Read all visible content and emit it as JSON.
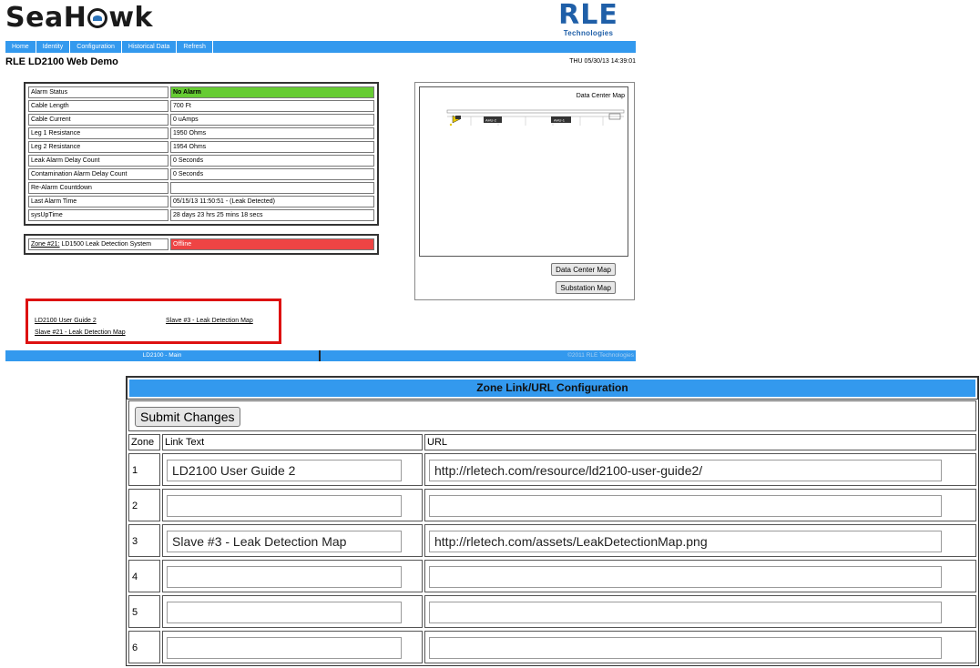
{
  "brand": {
    "logo_left": "SeaHawk",
    "logo_left_a": "SeaH",
    "logo_left_b": "wk",
    "logo_right": "RLE",
    "logo_right_sub": "Technologies"
  },
  "colors": {
    "accent": "#3399ee",
    "ok": "#66cc33",
    "alarm": "#ee4444",
    "highlight": "#dd1111"
  },
  "nav": {
    "items": [
      "Home",
      "Identity",
      "Configuration",
      "Historical Data",
      "Refresh"
    ]
  },
  "header": {
    "title": "RLE LD2100 Web Demo",
    "datetime": "THU 05/30/13 14:39:01"
  },
  "status": {
    "rows": [
      {
        "label": "Alarm Status",
        "value": "No Alarm"
      },
      {
        "label": "Cable Length",
        "value": "700 Ft"
      },
      {
        "label": "Cable Current",
        "value": "0 uAmps"
      },
      {
        "label": "Leg 1 Resistance",
        "value": "1950 Ohms"
      },
      {
        "label": "Leg 2 Resistance",
        "value": "1954 Ohms"
      },
      {
        "label": "Leak Alarm Delay Count",
        "value": "0 Seconds"
      },
      {
        "label": "Contamination Alarm Delay Count",
        "value": "0 Seconds"
      },
      {
        "label": "Re-Alarm Countdown",
        "value": ""
      },
      {
        "label": "Last Alarm Time",
        "value": "05/15/13 11:50:51  -  (Leak Detected)"
      },
      {
        "label": "sysUpTime",
        "value": "28 days 23 hrs 25 mins 18 secs"
      }
    ],
    "zone": {
      "link": "Zone #21:",
      "label": " LD1500 Leak Detection System",
      "value": "Offline"
    }
  },
  "map": {
    "title": "Data Center Map",
    "buttons": [
      "Data Center Map",
      "Substation Map"
    ],
    "unit_labels": [
      "AHU-2",
      "AHU-1"
    ]
  },
  "links": [
    "LD2100 User Guide 2",
    "Slave #3 - Leak Detection Map",
    "Slave #21 - Leak Detection Map"
  ],
  "footer": {
    "left": "LD2100 - Main",
    "right": "©2011 RLE Technologies"
  },
  "config": {
    "title": "Zone Link/URL Configuration",
    "submit_label": "Submit Changes",
    "headers": [
      "Zone",
      "Link Text",
      "URL"
    ],
    "rows": [
      {
        "zone": "1",
        "text": "LD2100 User Guide 2",
        "url": "http://rletech.com/resource/ld2100-user-guide2/"
      },
      {
        "zone": "2",
        "text": "",
        "url": ""
      },
      {
        "zone": "3",
        "text": "Slave #3 - Leak Detection Map",
        "url": "http://rletech.com/assets/LeakDetectionMap.png"
      },
      {
        "zone": "4",
        "text": "",
        "url": ""
      },
      {
        "zone": "5",
        "text": "",
        "url": ""
      },
      {
        "zone": "6",
        "text": "",
        "url": ""
      }
    ]
  }
}
